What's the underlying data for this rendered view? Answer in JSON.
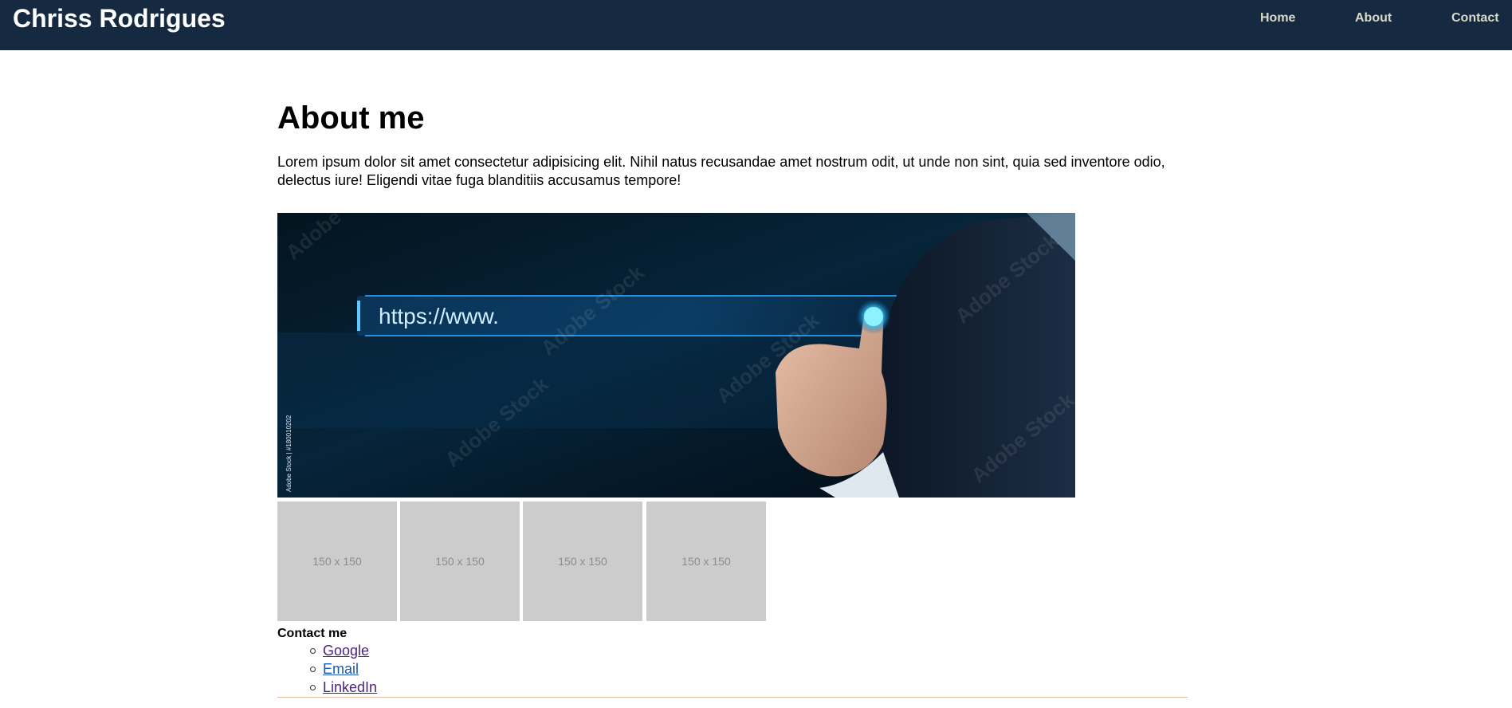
{
  "header": {
    "brand": "Chriss Rodrigues",
    "nav": [
      {
        "label": "Home"
      },
      {
        "label": "About"
      },
      {
        "label": "Contact"
      }
    ]
  },
  "main": {
    "heading": "About me",
    "intro": "Lorem ipsum dolor sit amet consectetur adipisicing elit. Nihil natus recusandae amet nostrum odit, ut unde non sint, quia sed inventore odio, delectus iure! Eligendi vitae fuga blanditiis accusamus tempore!",
    "hero_image": {
      "url_text": "https://www.",
      "watermark": "Adobe Stock",
      "stock_id": "Adobe Stock | #180010202"
    },
    "thumbnails": [
      {
        "label": "150 x 150"
      },
      {
        "label": "150 x 150"
      },
      {
        "label": "150 x 150"
      },
      {
        "label": "150 x 150"
      }
    ],
    "contact": {
      "title": "Contact me",
      "links": [
        {
          "label": "Google",
          "color": "#4b237c"
        },
        {
          "label": "Email",
          "color": "#1a58b4"
        },
        {
          "label": "LinkedIn",
          "color": "#4b237c"
        }
      ]
    }
  },
  "colors": {
    "header_bg": "#152940",
    "nav_text": "#d9dac9",
    "thumb_bg": "#cccccc",
    "divider": "#e8b79f"
  }
}
